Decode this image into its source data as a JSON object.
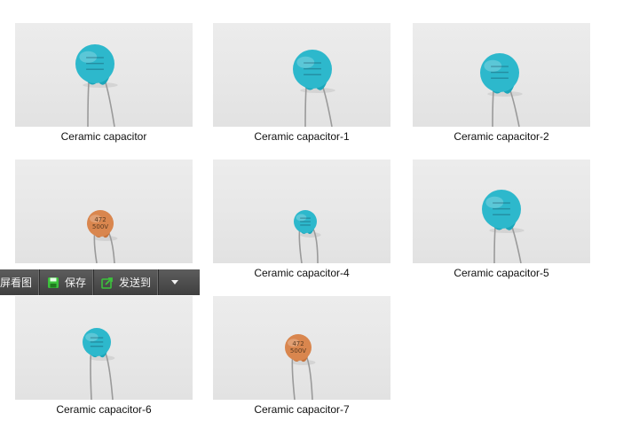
{
  "gallery": {
    "items": [
      {
        "caption": "Ceramic capacitor",
        "color": "#2db8cc",
        "kind": "blue-large",
        "marking": ""
      },
      {
        "caption": "Ceramic capacitor-1",
        "color": "#2db8cc",
        "kind": "blue-large",
        "marking": ""
      },
      {
        "caption": "Ceramic capacitor-2",
        "color": "#2db8cc",
        "kind": "blue-large",
        "marking": ""
      },
      {
        "caption": "",
        "color": "#d9864e",
        "kind": "orange-small",
        "marking": "472 500V"
      },
      {
        "caption": "Ceramic capacitor-4",
        "color": "#2db8cc",
        "kind": "blue-small",
        "marking": ""
      },
      {
        "caption": "Ceramic capacitor-5",
        "color": "#2db8cc",
        "kind": "blue-large",
        "marking": ""
      },
      {
        "caption": "Ceramic capacitor-6",
        "color": "#2db8cc",
        "kind": "blue-medium",
        "marking": ""
      },
      {
        "caption": "Ceramic capacitor-7",
        "color": "#d9864e",
        "kind": "orange-small",
        "marking": "472 500V"
      }
    ]
  },
  "toolbar": {
    "screenshot_label": "屏看图",
    "save_label": "保存",
    "send_label": "发送到",
    "save_icon_color": "#3cc23c",
    "send_icon_color": "#3cc23c"
  }
}
